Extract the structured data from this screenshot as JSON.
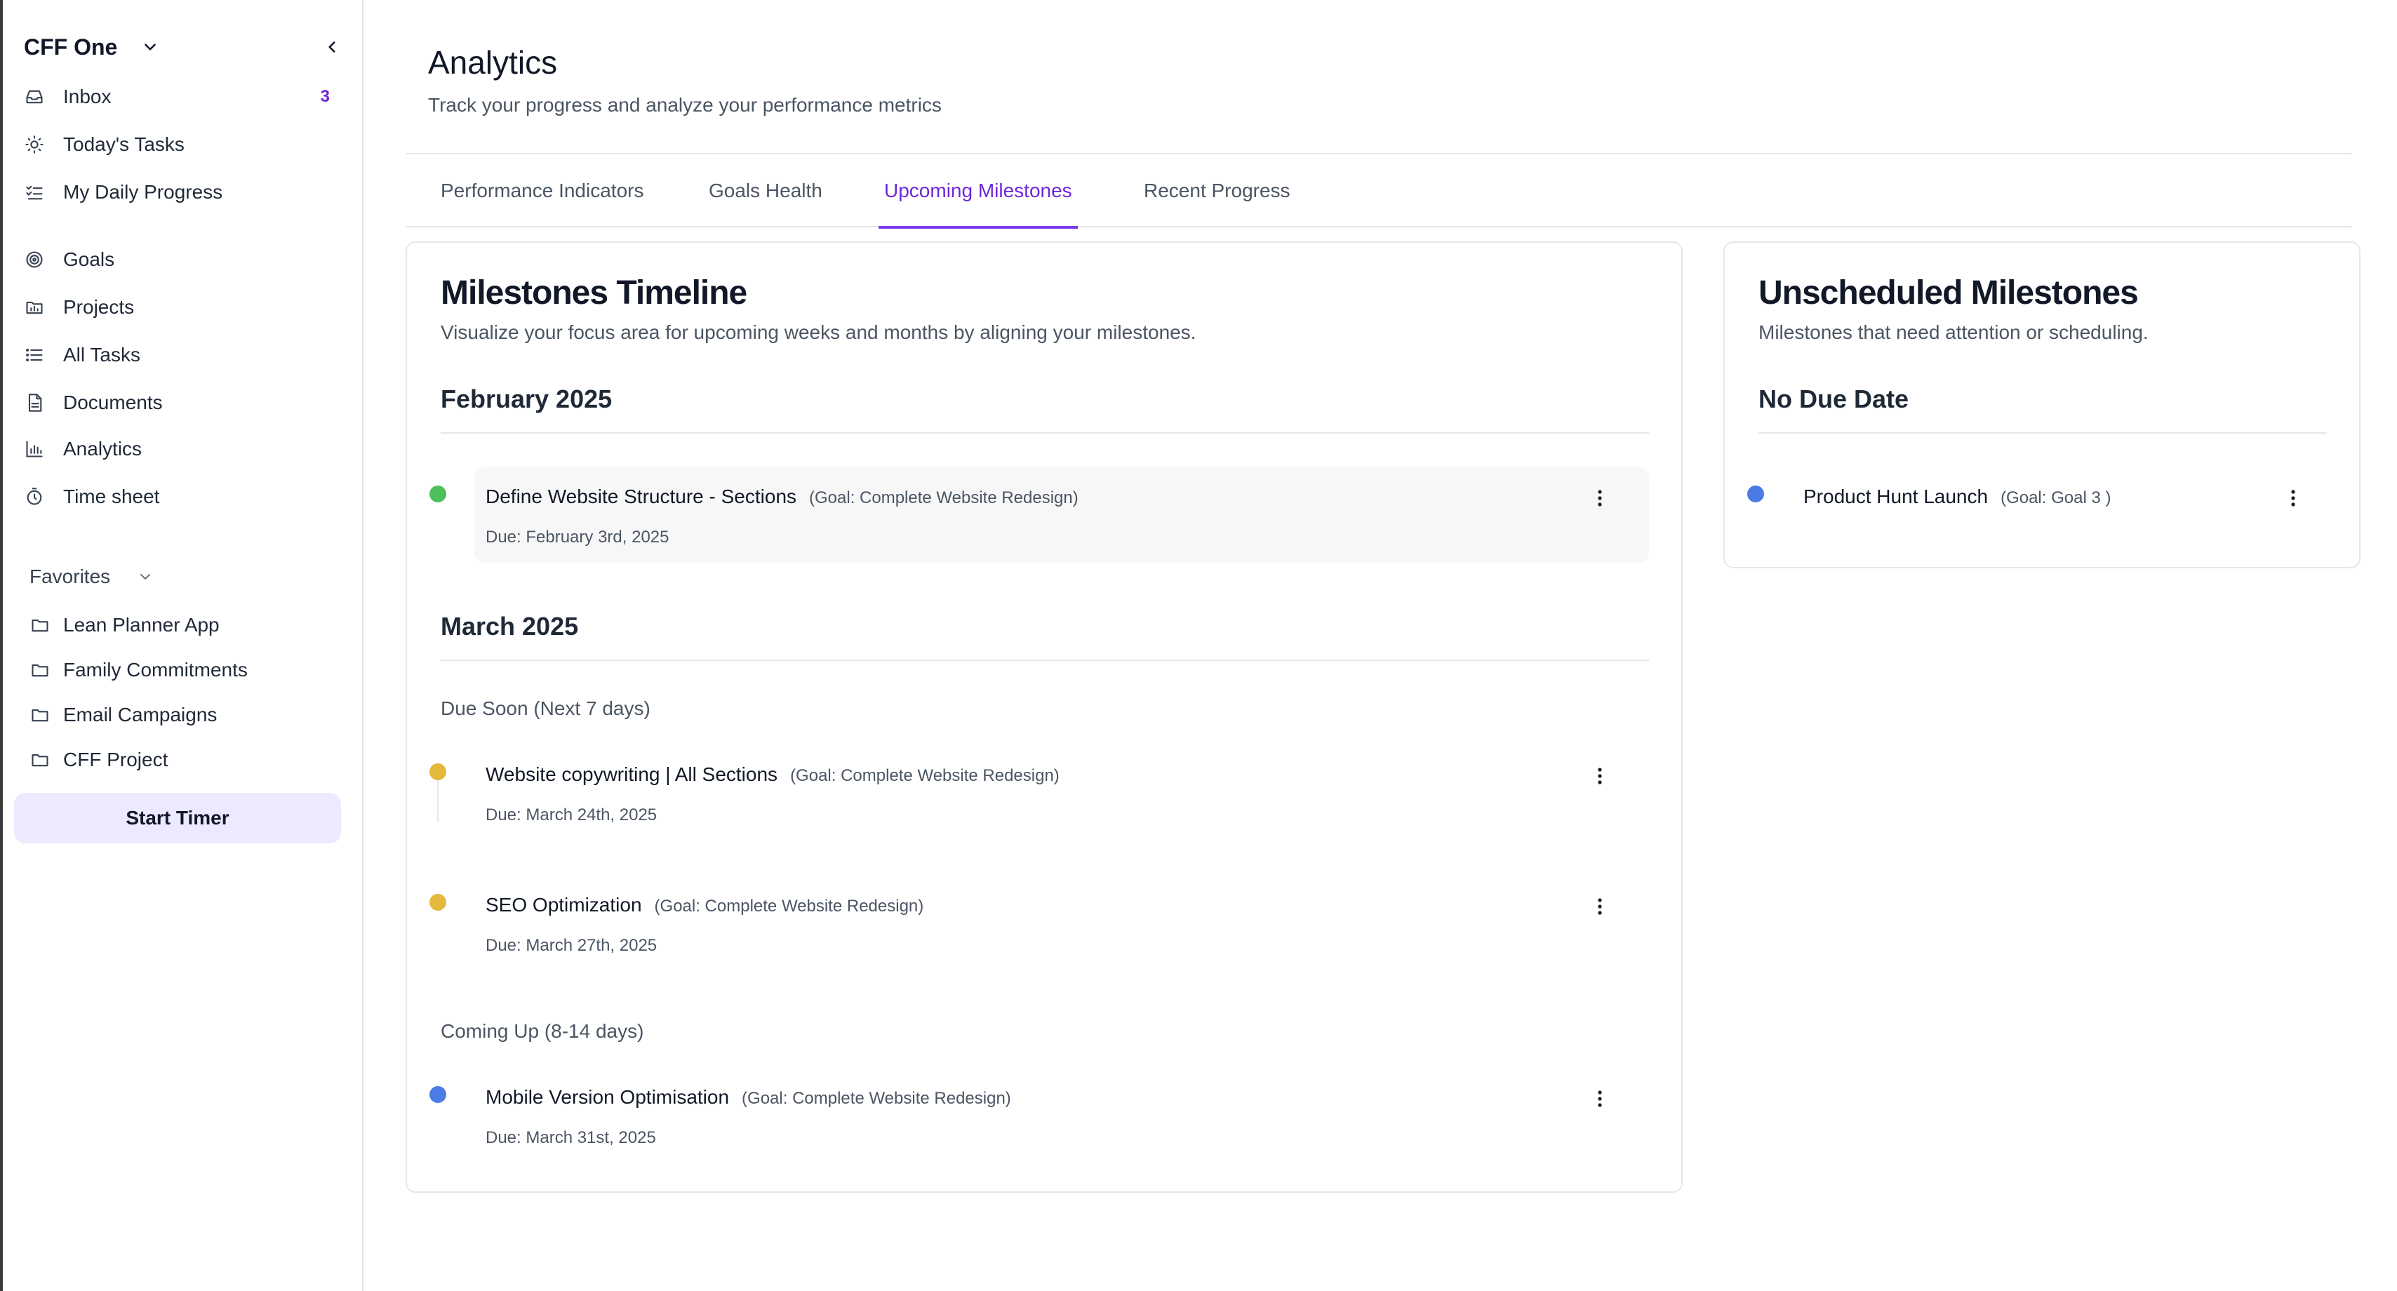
{
  "sidebar": {
    "workspace": "CFF One",
    "nav": [
      {
        "label": "Inbox",
        "icon": "inbox-icon",
        "badge": "3"
      },
      {
        "label": "Today's Tasks",
        "icon": "sun-icon"
      },
      {
        "label": "My Daily Progress",
        "icon": "checklist-icon"
      },
      {
        "label": "Goals",
        "icon": "target-icon"
      },
      {
        "label": "Projects",
        "icon": "folder-chart-icon"
      },
      {
        "label": "All Tasks",
        "icon": "list-icon"
      },
      {
        "label": "Documents",
        "icon": "document-icon"
      },
      {
        "label": "Analytics",
        "icon": "bar-chart-icon"
      },
      {
        "label": "Time sheet",
        "icon": "timer-icon"
      }
    ],
    "favorites_label": "Favorites",
    "favorites": [
      {
        "label": "Lean Planner App",
        "icon": "folder-icon"
      },
      {
        "label": "Family Commitments",
        "icon": "folder-icon"
      },
      {
        "label": "Email Campaigns",
        "icon": "folder-icon"
      },
      {
        "label": "CFF Project",
        "icon": "folder-icon"
      }
    ],
    "timer_button": "Start Timer"
  },
  "header": {
    "title": "Analytics",
    "subtitle": "Track your progress and analyze your performance metrics"
  },
  "tabs": [
    {
      "label": "Performance Indicators",
      "active": false
    },
    {
      "label": "Goals Health",
      "active": false
    },
    {
      "label": "Upcoming Milestones",
      "active": true
    },
    {
      "label": "Recent Progress",
      "active": false
    }
  ],
  "timeline": {
    "title": "Milestones Timeline",
    "subtitle": "Visualize your focus area for upcoming weeks and months by aligning your milestones.",
    "months": [
      {
        "label": "February 2025",
        "groups": [
          {
            "label": "",
            "milestones": [
              {
                "name": "Define Website Structure - Sections",
                "goal": "(Goal: Complete Website Redesign)",
                "due": "Due: February 3rd, 2025",
                "status_color": "#4cc05a"
              }
            ]
          }
        ]
      },
      {
        "label": "March 2025",
        "groups": [
          {
            "label": "Due Soon (Next 7 days)",
            "milestones": [
              {
                "name": "Website copywriting | All Sections",
                "goal": "(Goal: Complete Website Redesign)",
                "due": "Due: March 24th, 2025",
                "status_color": "#e2b93b"
              },
              {
                "name": "SEO Optimization",
                "goal": "(Goal: Complete Website Redesign)",
                "due": "Due: March 27th, 2025",
                "status_color": "#e2b93b"
              }
            ]
          },
          {
            "label": "Coming Up (8-14 days)",
            "milestones": [
              {
                "name": "Mobile Version Optimisation",
                "goal": "(Goal: Complete Website Redesign)",
                "due": "Due: March 31st, 2025",
                "status_color": "#4b7be5"
              }
            ]
          }
        ]
      }
    ]
  },
  "unscheduled": {
    "title": "Unscheduled Milestones",
    "subtitle": "Milestones that need attention or scheduling.",
    "section": "No Due Date",
    "milestones": [
      {
        "name": "Product Hunt Launch",
        "goal": "(Goal: Goal 3 )",
        "status_color": "#4b7be5"
      }
    ]
  }
}
